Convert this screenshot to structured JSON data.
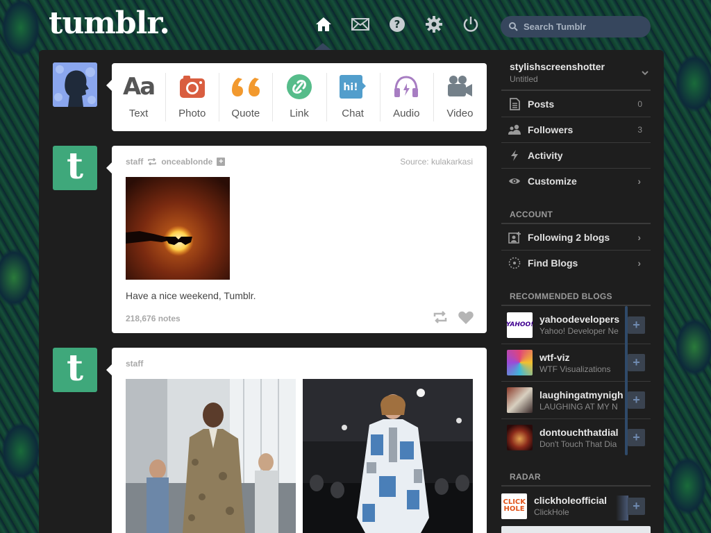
{
  "header": {
    "logo": "tumblr.",
    "search_placeholder": "Search Tumblr",
    "nav_icons": [
      "home-icon",
      "mail-icon",
      "help-icon",
      "settings-icon",
      "power-icon"
    ]
  },
  "post_types": [
    {
      "label": "Text",
      "icon": "text-icon",
      "color": "#555555"
    },
    {
      "label": "Photo",
      "icon": "camera-icon",
      "color": "#d95e40"
    },
    {
      "label": "Quote",
      "icon": "quote-icon",
      "color": "#f2992e"
    },
    {
      "label": "Link",
      "icon": "link-icon",
      "color": "#56bc8a"
    },
    {
      "label": "Chat",
      "icon": "chat-icon",
      "color": "#529ecc"
    },
    {
      "label": "Audio",
      "icon": "headphones-icon",
      "color": "#a77dc2"
    },
    {
      "label": "Video",
      "icon": "video-camera-icon",
      "color": "#748089"
    }
  ],
  "posts": [
    {
      "author": "staff",
      "reblogged_from": "onceablonde",
      "source_label": "Source:",
      "source_name": "kulakarkasi",
      "caption": "Have a nice weekend, Tumblr.",
      "notes": "218,676 notes"
    },
    {
      "author": "staff"
    }
  ],
  "sidebar": {
    "blog_name": "stylishscreenshotter",
    "blog_title": "Untitled",
    "menu": [
      {
        "label": "Posts",
        "icon": "posts-icon",
        "count": "0"
      },
      {
        "label": "Followers",
        "icon": "followers-icon",
        "count": "3"
      },
      {
        "label": "Activity",
        "icon": "lightning-icon",
        "count": ""
      },
      {
        "label": "Customize",
        "icon": "eye-icon",
        "count": ""
      }
    ],
    "account_header": "ACCOUNT",
    "account_items": [
      {
        "label": "Following 2 blogs",
        "icon": "following-icon"
      },
      {
        "label": "Find Blogs",
        "icon": "find-blogs-icon"
      }
    ],
    "recommended_header": "RECOMMENDED BLOGS",
    "recommended": [
      {
        "name": "yahoodevelopers",
        "title": "Yahoo! Developer Ne",
        "thumb": "yahoo"
      },
      {
        "name": "wtf-viz",
        "title": "WTF Visualizations",
        "thumb": "wtfviz"
      },
      {
        "name": "laughingatmynigh",
        "title": "LAUGHING AT MY N",
        "thumb": "laughing"
      },
      {
        "name": "dontouchthatdial",
        "title": "Don't Touch That Dia",
        "thumb": "dial"
      }
    ],
    "radar_header": "RADAR",
    "radar": {
      "name": "clickholeofficial",
      "title": "ClickHole",
      "logo_text": "CLICK HOLE"
    },
    "yahoo_logo": "YAHOO!"
  }
}
